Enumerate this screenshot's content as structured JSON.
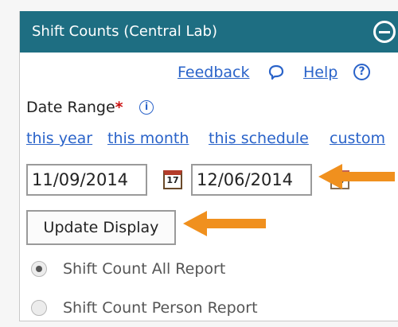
{
  "panel": {
    "title": "Shift Counts (Central Lab)",
    "collapse_icon": "minus-circle-icon"
  },
  "links": {
    "feedback": "Feedback",
    "help": "Help",
    "help_icon": "?"
  },
  "date_range": {
    "label": "Date Range",
    "required_marker": "*",
    "info_icon": "i",
    "quick_links": [
      "this year",
      "this month",
      "this schedule",
      "custom"
    ],
    "start_date": "11/09/2014",
    "end_date": "12/06/2014",
    "calendar_icon_text": "17"
  },
  "update_button": "Update Display",
  "report_options": [
    {
      "label": "Shift Count All Report",
      "selected": true
    },
    {
      "label": "Shift Count Person Report",
      "selected": false
    }
  ],
  "colors": {
    "header_bg": "#1e6e82",
    "link": "#2a63c9",
    "arrow": "#f0901e",
    "required": "#cc1111"
  }
}
